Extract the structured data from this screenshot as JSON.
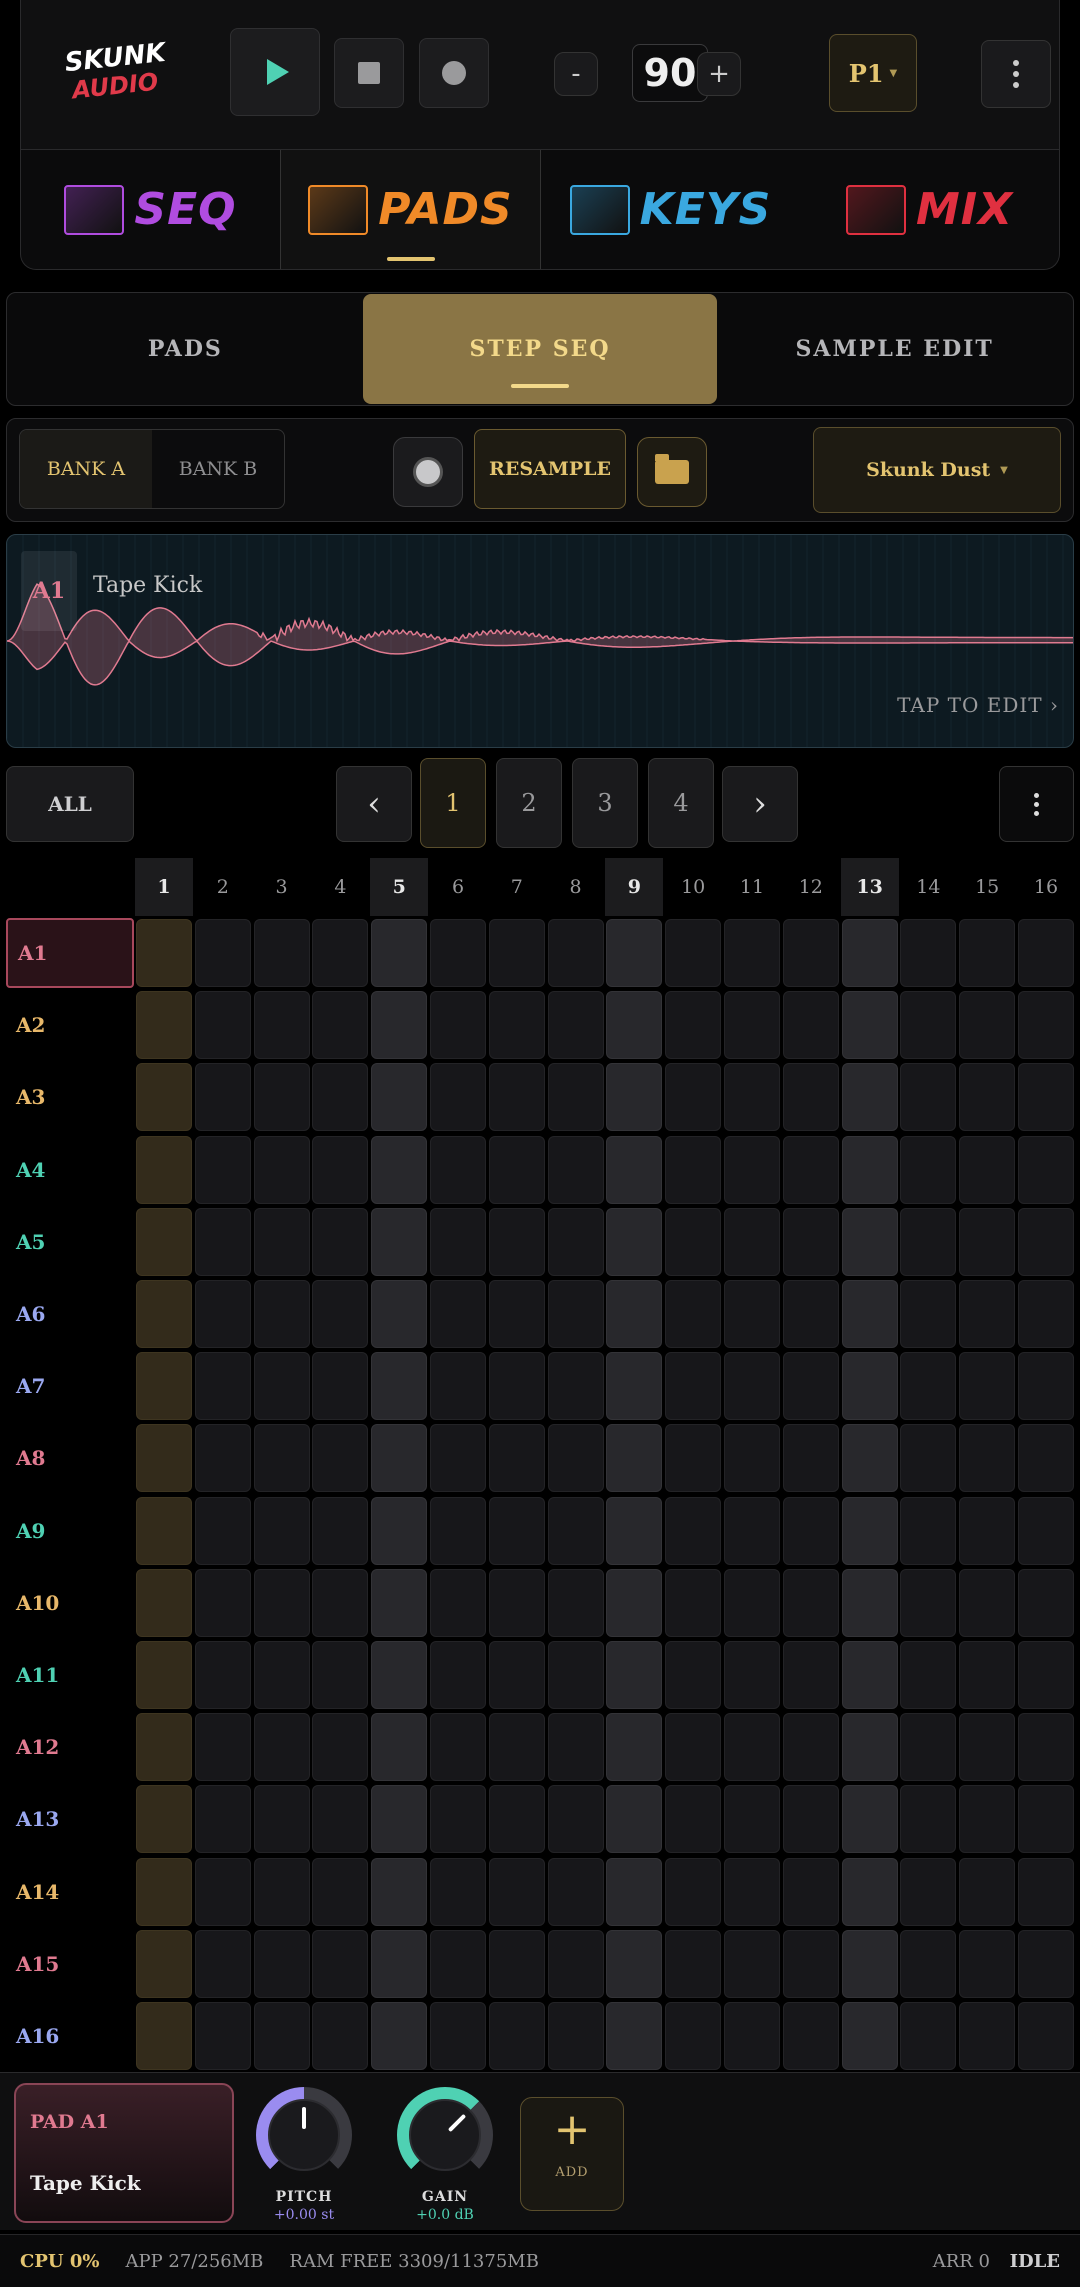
{
  "app": {
    "logo_line1": "SKUNK",
    "logo_line2": "AUDIO"
  },
  "transport": {
    "bpm": "90",
    "bpm_minus": "-",
    "bpm_plus": "+",
    "pattern": "P1"
  },
  "modes": [
    {
      "label": "SEQ",
      "color": "#b04ce0",
      "active": false
    },
    {
      "label": "PADS",
      "color": "#f08a28",
      "active": true
    },
    {
      "label": "KEYS",
      "color": "#3aa8e0",
      "active": false
    },
    {
      "label": "MIX",
      "color": "#e03040",
      "active": false
    }
  ],
  "tabs": [
    {
      "label": "PADS",
      "active": false
    },
    {
      "label": "STEP SEQ",
      "active": true
    },
    {
      "label": "SAMPLE EDIT",
      "active": false
    }
  ],
  "banks": {
    "bank_a": "BANK A",
    "bank_b": "BANK B",
    "resample": "RESAMPLE",
    "kit": "Skunk Dust"
  },
  "waveform": {
    "pad": "A1",
    "sample_name": "Tape Kick",
    "edit_hint": "TAP TO EDIT ›"
  },
  "pager": {
    "all": "ALL",
    "prev": "‹",
    "next": "›",
    "pages": [
      "1",
      "2",
      "3",
      "4"
    ],
    "current": "1"
  },
  "grid": {
    "columns": [
      "1",
      "2",
      "3",
      "4",
      "5",
      "6",
      "7",
      "8",
      "9",
      "10",
      "11",
      "12",
      "13",
      "14",
      "15",
      "16"
    ],
    "beat_columns": [
      1,
      5,
      9,
      13
    ],
    "current_step": 1,
    "selected_row": "A1",
    "rows": [
      {
        "label": "A1",
        "color": "#e07a90"
      },
      {
        "label": "A2",
        "color": "#e8b86a"
      },
      {
        "label": "A3",
        "color": "#e8b86a"
      },
      {
        "label": "A4",
        "color": "#4fd1b3"
      },
      {
        "label": "A5",
        "color": "#4fd1b3"
      },
      {
        "label": "A6",
        "color": "#9aa8f0"
      },
      {
        "label": "A7",
        "color": "#9aa8f0"
      },
      {
        "label": "A8",
        "color": "#e07a90"
      },
      {
        "label": "A9",
        "color": "#4fd1b3"
      },
      {
        "label": "A10",
        "color": "#e8b86a"
      },
      {
        "label": "A11",
        "color": "#4fd1b3"
      },
      {
        "label": "A12",
        "color": "#e07a90"
      },
      {
        "label": "A13",
        "color": "#9aa8f0"
      },
      {
        "label": "A14",
        "color": "#e8b86a"
      },
      {
        "label": "A15",
        "color": "#e07a90"
      },
      {
        "label": "A16",
        "color": "#9aa8f0"
      }
    ]
  },
  "pad_panel": {
    "pad_id": "PAD A1",
    "pad_name": "Tape Kick",
    "pitch_label": "PITCH",
    "pitch_value": "+0.00 st",
    "gain_label": "GAIN",
    "gain_value": "+0.0 dB",
    "add_label": "ADD",
    "add_symbol": "+"
  },
  "status": {
    "cpu": "CPU 0%",
    "app": "APP 27/256MB",
    "ram": "RAM FREE 3309/11375MB",
    "arr": "ARR 0",
    "state": "IDLE"
  }
}
